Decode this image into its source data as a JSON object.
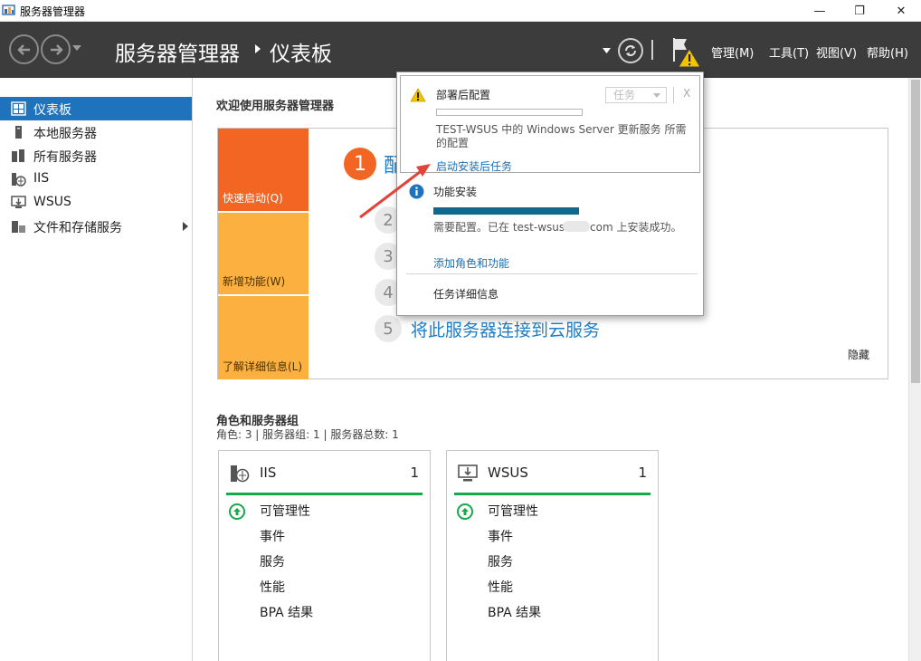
{
  "window": {
    "title": "服务器管理器",
    "minimize_glyph": "—",
    "restore_glyph": "❐",
    "close_glyph": "✕"
  },
  "header": {
    "breadcrumb_app": "服务器管理器",
    "breadcrumb_page": "仪表板",
    "menus": [
      "管理(M)",
      "工具(T)",
      "视图(V)",
      "帮助(H)"
    ]
  },
  "sidebar": {
    "items": [
      {
        "label": "仪表板",
        "icon": "dashboard-icon",
        "active": true
      },
      {
        "label": "本地服务器",
        "icon": "server-icon"
      },
      {
        "label": "所有服务器",
        "icon": "servers-icon"
      },
      {
        "label": "IIS",
        "icon": "iis-icon"
      },
      {
        "label": "WSUS",
        "icon": "wsus-icon"
      },
      {
        "label": "文件和存储服务",
        "icon": "storage-icon",
        "has_submenu": true
      }
    ]
  },
  "welcome": {
    "title": "欢迎使用服务器管理器",
    "tiles": [
      {
        "label": "快速启动(Q)",
        "color": "#f26522"
      },
      {
        "label": "新增功能(W)",
        "color": "#fbb040"
      },
      {
        "label": "了解详细信息(L)",
        "color": "#fbb040"
      }
    ],
    "steps": [
      {
        "num": "1",
        "text": "配"
      },
      {
        "num": "2",
        "text": ""
      },
      {
        "num": "3",
        "text": ""
      },
      {
        "num": "4",
        "text": ""
      },
      {
        "num": "5",
        "text": "将此服务器连接到云服务"
      }
    ],
    "hide_label": "隐藏"
  },
  "roles": {
    "title": "角色和服务器组",
    "summary": "角色: 3 | 服务器组: 1 | 服务器总数: 1",
    "cards": [
      {
        "name": "IIS",
        "count": "1",
        "icon": "iis-icon",
        "rows": [
          "可管理性",
          "事件",
          "服务",
          "性能",
          "BPA 结果"
        ]
      },
      {
        "name": "WSUS",
        "count": "1",
        "icon": "wsus-icon",
        "rows": [
          "可管理性",
          "事件",
          "服务",
          "性能",
          "BPA 结果"
        ]
      }
    ]
  },
  "notification": {
    "post_deploy": {
      "title": "部署后配置",
      "tasks_label": "任务",
      "close_label": "X",
      "desc": "TEST-WSUS 中的 Windows Server 更新服务 所需的配置",
      "link": "启动安装后任务"
    },
    "feature_install": {
      "title": "功能安装",
      "progress": 1.0,
      "desc_prefix": "需要配置。已在 test-wsus",
      "desc_suffix": "com 上安装成功。",
      "link": "添加角色和功能"
    },
    "task_details": "任务详细信息"
  },
  "colors": {
    "accent": "#1f73bd",
    "header_bg": "#3c3c3c",
    "tile_orange": "#f26522",
    "tile_yellow": "#fbb040",
    "ok_green": "#17a84a",
    "warning": "#f5c400",
    "annotation_arrow": "#e0443a"
  }
}
